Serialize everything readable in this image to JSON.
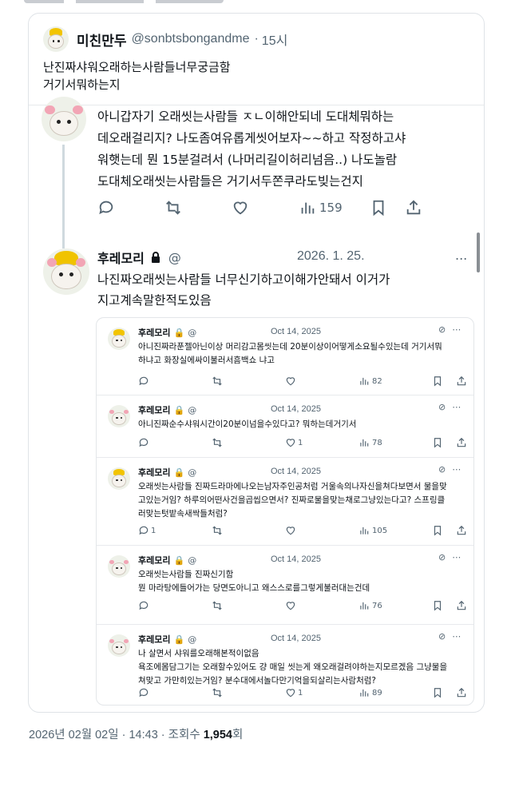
{
  "quote": {
    "name": "미친만두",
    "handle": "@sonbtsbongandme",
    "time": "15시",
    "text_line1": "난진짜샤워오래하는사람들너무궁금함",
    "text_line2": "거기서뭐하는지"
  },
  "tweet1": {
    "lines": [
      "아니갑자기 오래씻는사람들 ㅈㄴ이해안되네 도대체뭐하는",
      "데오래걸리지? 나도좀여유롭게씻어보자~~하고 작정하고샤",
      "워햇는데 뭔 15분걸려서 (나머리길이허리넘음..) 나도놀람",
      "도대체오래씻는사람들은 거기서두쫀쿠라도빚는건지"
    ],
    "views": "159"
  },
  "tweet2": {
    "name": "후레모리",
    "at": "@",
    "date": "2026. 1. 25.",
    "more": "...",
    "lines": [
      "나진짜오래씻는사람들 너무신기하고이해가안돼서 이거가",
      "지고계속말한적도있음"
    ]
  },
  "subtweets": [
    {
      "name": "후레모리",
      "at": "@",
      "date": "Oct 14, 2025",
      "lines": [
        "아니진짜라푼젤아닌이상 머리감고몸씻는데 20분이상이어떻게소요될수있는데 거기서뭐",
        "하냐고 화장실에싸이불러서흠백쇼 냐고"
      ],
      "reply": "",
      "retweet": "",
      "like": "",
      "views": "82"
    },
    {
      "name": "후레모리",
      "at": "@",
      "date": "Oct 14, 2025",
      "lines": [
        "아니진짜순수샤워시간이20분이넘을수있다고? 뭐하는데거기서"
      ],
      "reply": "",
      "retweet": "",
      "like": "1",
      "views": "78"
    },
    {
      "name": "후레모리",
      "at": "@",
      "date": "Oct 14, 2025",
      "lines": [
        "오래씻는사람들 진짜드라마에나오는남자주인공처럼 거울속의나자신을쳐다보면서 물을맞",
        "고있는거임? 하루의어떤사건을곱씹으면서? 진짜로물을맞는채로그냥있는다고? 스프링클",
        "러맞는텃밭속새싹들처럼?"
      ],
      "reply": "1",
      "retweet": "",
      "like": "",
      "views": "105"
    },
    {
      "name": "후레모리",
      "at": "@",
      "date": "Oct 14, 2025",
      "lines": [
        "오래씻는사람들 진짜신기함",
        "뭔 마라탕에들어가는 당면도아니고 왜스스로를그렇게불러대는건데"
      ],
      "reply": "",
      "retweet": "",
      "like": "",
      "views": "76"
    },
    {
      "name": "후레모리",
      "at": "@",
      "date": "Oct 14, 2025",
      "lines": [
        "나 살면서 샤워를오래해본적이없음",
        "욕조에몸담그기는 오래할수있어도 걍 매일 씻는게 왜오래걸려야하는지모르겠음 그냥물을",
        "쳐맞고 가만히있는거임? 분수대에서놀다만기억을되살리는사람처럼?"
      ],
      "reply": "",
      "retweet": "",
      "like": "1",
      "views": "89"
    }
  ],
  "footer": {
    "datetime": "2026년 02월 02일 · 14:43 · 조회수 ",
    "views": "1,954",
    "suffix": "회"
  }
}
